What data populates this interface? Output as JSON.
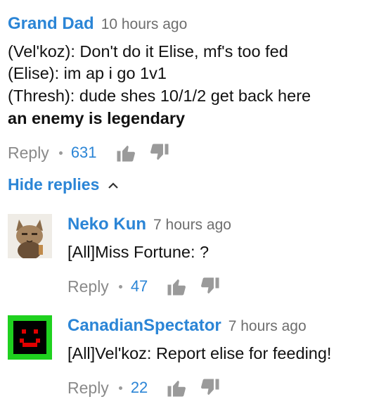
{
  "comment": {
    "author": "Grand Dad",
    "time": "10 hours ago",
    "lines": [
      "(Vel'koz): Don't do it Elise, mf's too fed",
      "(Elise): im ap i go 1v1",
      "(Thresh): dude shes 10/1/2 get back here"
    ],
    "bold_line": "an enemy is legendary",
    "reply_label": "Reply",
    "likes": "631"
  },
  "hide_replies_label": "Hide replies",
  "replies": [
    {
      "author": "Neko Kun",
      "time": "7 hours ago",
      "text": "[All]Miss Fortune: ?",
      "reply_label": "Reply",
      "likes": "47",
      "avatar": "cat-avatar"
    },
    {
      "author": "CanadianSpectator",
      "time": "7 hours ago",
      "text": "[All]Vel'koz: Report elise for feeding!",
      "reply_label": "Reply",
      "likes": "22",
      "avatar": "smiley-avatar"
    }
  ],
  "colors": {
    "author": "#2b85d6",
    "time": "#6e6e6e",
    "reply": "#8a8a8a",
    "avatar_green": "#1fd11f",
    "avatar_red": "#e00000"
  }
}
